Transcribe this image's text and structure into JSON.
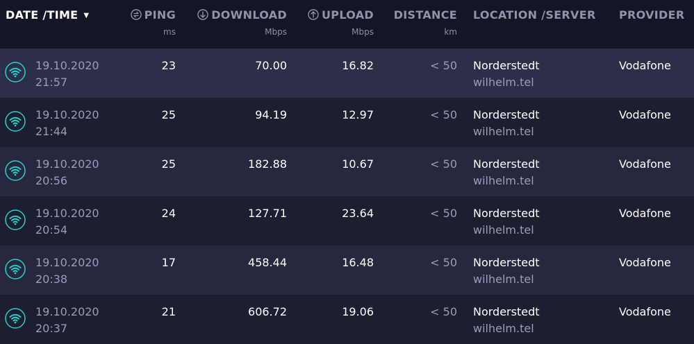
{
  "header": {
    "date_time": "DATE /TIME",
    "ping": "PING",
    "ping_unit": "ms",
    "download": "DOWNLOAD",
    "download_unit": "Mbps",
    "upload": "UPLOAD",
    "upload_unit": "Mbps",
    "distance": "DISTANCE",
    "distance_unit": "km",
    "location_server": "LOCATION /SERVER",
    "provider": "PROVIDER"
  },
  "colors": {
    "accent_wifi": "#27d3c9",
    "background": "#141526",
    "row_dark": "#1d1e32",
    "row_light": "#272840"
  },
  "rows": [
    {
      "date": "19.10.2020",
      "time": "21:57",
      "ping": "23",
      "download": "70.00",
      "upload": "16.82",
      "distance": "< 50",
      "location": "Norderstedt",
      "server": "wilhelm.tel",
      "provider": "Vodafone",
      "icon": "wifi-icon"
    },
    {
      "date": "19.10.2020",
      "time": "21:44",
      "ping": "25",
      "download": "94.19",
      "upload": "12.97",
      "distance": "< 50",
      "location": "Norderstedt",
      "server": "wilhelm.tel",
      "provider": "Vodafone",
      "icon": "wifi-icon"
    },
    {
      "date": "19.10.2020",
      "time": "20:56",
      "ping": "25",
      "download": "182.88",
      "upload": "10.67",
      "distance": "< 50",
      "location": "Norderstedt",
      "server": "wilhelm.tel",
      "provider": "Vodafone",
      "icon": "wifi-icon"
    },
    {
      "date": "19.10.2020",
      "time": "20:54",
      "ping": "24",
      "download": "127.71",
      "upload": "23.64",
      "distance": "< 50",
      "location": "Norderstedt",
      "server": "wilhelm.tel",
      "provider": "Vodafone",
      "icon": "wifi-icon"
    },
    {
      "date": "19.10.2020",
      "time": "20:38",
      "ping": "17",
      "download": "458.44",
      "upload": "16.48",
      "distance": "< 50",
      "location": "Norderstedt",
      "server": "wilhelm.tel",
      "provider": "Vodafone",
      "icon": "wifi-icon"
    },
    {
      "date": "19.10.2020",
      "time": "20:37",
      "ping": "21",
      "download": "606.72",
      "upload": "19.06",
      "distance": "< 50",
      "location": "Norderstedt",
      "server": "wilhelm.tel",
      "provider": "Vodafone",
      "icon": "wifi-icon"
    }
  ]
}
